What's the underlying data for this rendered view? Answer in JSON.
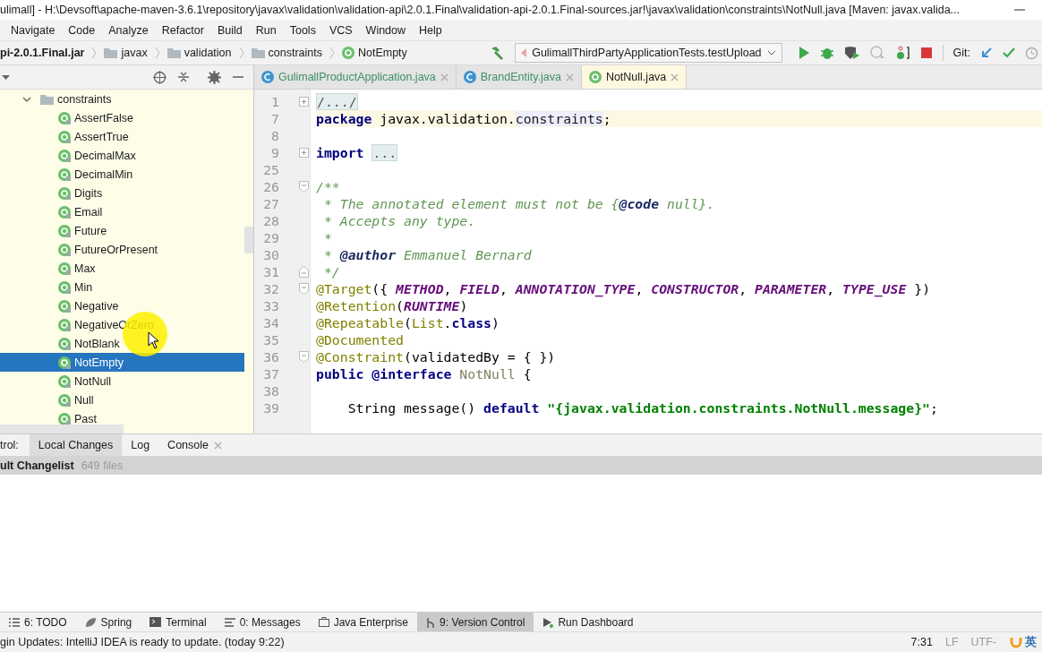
{
  "window": {
    "title": "ulimall] - H:\\Devsoft\\apache-maven-3.6.1\\repository\\javax\\validation\\validation-api\\2.0.1.Final\\validation-api-2.0.1.Final-sources.jar!\\javax\\validation\\constraints\\NotNull.java [Maven: javax.valida..."
  },
  "menu": [
    "Navigate",
    "Code",
    "Analyze",
    "Refactor",
    "Build",
    "Run",
    "Tools",
    "VCS",
    "Window",
    "Help"
  ],
  "breadcrumbs": [
    {
      "label": "pi-2.0.1.Final.jar",
      "kind": "jar"
    },
    {
      "label": "javax",
      "kind": "folder"
    },
    {
      "label": "validation",
      "kind": "folder"
    },
    {
      "label": "constraints",
      "kind": "folder"
    },
    {
      "label": "NotEmpty",
      "kind": "annotation"
    }
  ],
  "run_config": "GulimallThirdPartyApplicationTests.testUpload",
  "git_label": "Git:",
  "tree": [
    {
      "label": "constraints",
      "expanded": true,
      "children": [
        {
          "label": "AssertFalse",
          "selected": false
        },
        {
          "label": "AssertTrue",
          "selected": false
        },
        {
          "label": "DecimalMax",
          "selected": false
        },
        {
          "label": "DecimalMin",
          "selected": false
        },
        {
          "label": "Digits",
          "selected": false
        },
        {
          "label": "Email",
          "selected": false
        },
        {
          "label": "Future",
          "selected": false
        },
        {
          "label": "FutureOrPresent",
          "selected": false
        },
        {
          "label": "Max",
          "selected": false
        },
        {
          "label": "Min",
          "selected": false
        },
        {
          "label": "Negative",
          "selected": false
        },
        {
          "label": "NegativeOrZero",
          "selected": false
        },
        {
          "label": "NotBlank",
          "selected": false
        },
        {
          "label": "NotEmpty",
          "selected": true
        },
        {
          "label": "NotNull",
          "selected": false
        },
        {
          "label": "Null",
          "selected": false
        },
        {
          "label": "Past",
          "selected": false
        }
      ]
    }
  ],
  "editor_tabs": [
    {
      "label": "GulimallProductApplication.java",
      "kind": "class",
      "selected": false
    },
    {
      "label": "BrandEntity.java",
      "kind": "class",
      "selected": false
    },
    {
      "label": "NotNull.java",
      "kind": "annotation",
      "selected": true
    }
  ],
  "code": [
    {
      "num": "1",
      "fold": {
        "kind": "collapsed"
      },
      "tokens": [
        {
          "kind": "folded",
          "text": "/.../"
        }
      ]
    },
    {
      "num": "7",
      "current": true,
      "tokens": [
        {
          "kind": "keyword",
          "text": "package"
        },
        {
          "kind": "plain",
          "text": " javax.validation."
        },
        {
          "kind": "highlight",
          "text": "constraints"
        },
        {
          "kind": "plain",
          "text": ";"
        }
      ]
    },
    {
      "num": "8",
      "current": false
    },
    {
      "num": "9",
      "fold": {
        "kind": "collapsed"
      },
      "tokens": [
        {
          "kind": "keyword",
          "text": "import"
        },
        {
          "kind": "folded",
          "text": "..."
        }
      ]
    },
    {
      "num": "25",
      "current": false
    },
    {
      "num": "26",
      "fold": {
        "kind": "open"
      },
      "tokens": [
        {
          "kind": "doc",
          "text": "/**"
        }
      ]
    },
    {
      "num": "27",
      "tokens": [
        {
          "kind": "doc",
          "text": " * The annotated element must not be {"
        },
        {
          "kind": "doctag",
          "text": "@code"
        },
        {
          "kind": "doc",
          "text": " null}."
        }
      ]
    },
    {
      "num": "28",
      "tokens": [
        {
          "kind": "doc",
          "text": " * Accepts any type."
        }
      ]
    },
    {
      "num": "29",
      "tokens": [
        {
          "kind": "doc",
          "text": " *"
        }
      ]
    },
    {
      "num": "30",
      "tokens": [
        {
          "kind": "doc",
          "text": " * "
        },
        {
          "kind": "doctag",
          "text": "@author"
        },
        {
          "kind": "doc",
          "text": " Emmanuel Bernard"
        }
      ]
    },
    {
      "num": "31",
      "fold": {
        "kind": "close"
      },
      "tokens": [
        {
          "kind": "doc",
          "text": " */"
        }
      ]
    },
    {
      "num": "32",
      "fold": {
        "kind": "open"
      },
      "tokens": [
        {
          "kind": "annotation",
          "text": "@Target"
        },
        {
          "kind": "plain",
          "text": "({ "
        },
        {
          "kind": "constant",
          "text": "METHOD"
        },
        {
          "kind": "plain",
          "text": ", "
        },
        {
          "kind": "constant",
          "text": "FIELD"
        },
        {
          "kind": "plain",
          "text": ", "
        },
        {
          "kind": "constant",
          "text": "ANNOTATION_TYPE"
        },
        {
          "kind": "plain",
          "text": ", "
        },
        {
          "kind": "constant",
          "text": "CONSTRUCTOR"
        },
        {
          "kind": "plain",
          "text": ", "
        },
        {
          "kind": "constant",
          "text": "PARAMETER"
        },
        {
          "kind": "plain",
          "text": ", "
        },
        {
          "kind": "constant",
          "text": "TYPE_USE"
        },
        {
          "kind": "plain",
          "text": " })"
        }
      ]
    },
    {
      "num": "33",
      "tokens": [
        {
          "kind": "annotation",
          "text": "@Retention"
        },
        {
          "kind": "plain",
          "text": "("
        },
        {
          "kind": "constant",
          "text": "RUNTIME"
        },
        {
          "kind": "plain",
          "text": ")"
        }
      ]
    },
    {
      "num": "34",
      "tokens": [
        {
          "kind": "annotation",
          "text": "@Repeatable"
        },
        {
          "kind": "plain",
          "text": "("
        },
        {
          "kind": "annotation",
          "text": "List"
        },
        {
          "kind": "plain",
          "text": "."
        },
        {
          "kind": "keyword",
          "text": "class"
        },
        {
          "kind": "plain",
          "text": ")"
        }
      ]
    },
    {
      "num": "35",
      "tokens": [
        {
          "kind": "annotation",
          "text": "@Documented"
        }
      ]
    },
    {
      "num": "36",
      "fold": {
        "kind": "open"
      },
      "tokens": [
        {
          "kind": "annotation",
          "text": "@Constraint"
        },
        {
          "kind": "plain",
          "text": "(validatedBy = { })"
        }
      ]
    },
    {
      "num": "37",
      "tokens": [
        {
          "kind": "keyword",
          "text": "public"
        },
        {
          "kind": "keyword",
          "text": " @interface"
        },
        {
          "kind": "typename",
          "text": " NotNull"
        },
        {
          "kind": "plain",
          "text": " {"
        }
      ]
    },
    {
      "num": "38",
      "current": false
    },
    {
      "num": "39",
      "tokens": [
        {
          "kind": "plain",
          "text": "    String message()"
        },
        {
          "kind": "keyword",
          "text": " default"
        },
        {
          "kind": "string",
          "text": " \"{javax.validation.constraints.NotNull.message}\""
        },
        {
          "kind": "plain",
          "text": ";"
        }
      ]
    }
  ],
  "bottom_panel": {
    "label": "trol:",
    "tabs": [
      {
        "label": "Local Changes",
        "selected": true,
        "closable": false
      },
      {
        "label": "Log",
        "selected": false,
        "closable": false
      },
      {
        "label": "Console",
        "selected": false,
        "closable": true
      }
    ],
    "changelist": {
      "name": "ult Changelist",
      "count": "649 files"
    }
  },
  "tool_windows": [
    {
      "label": "6: TODO",
      "kind": "list",
      "selected": false
    },
    {
      "label": "Spring",
      "kind": "leaf",
      "selected": false
    },
    {
      "label": "Terminal",
      "kind": "terminal",
      "selected": false
    },
    {
      "label": "0: Messages",
      "kind": "messages",
      "selected": false
    },
    {
      "label": "Java Enterprise",
      "kind": "enterprise",
      "selected": false
    },
    {
      "label": "9: Version Control",
      "kind": "vcs",
      "selected": true
    },
    {
      "label": "Run Dashboard",
      "kind": "run",
      "selected": false
    }
  ],
  "status_bar": {
    "message": "gin Updates: IntelliJ IDEA is ready to update. (today 9:22)",
    "position": "7:31",
    "line_sep": "LF",
    "encoding": "UTF-",
    "ime": "英"
  }
}
